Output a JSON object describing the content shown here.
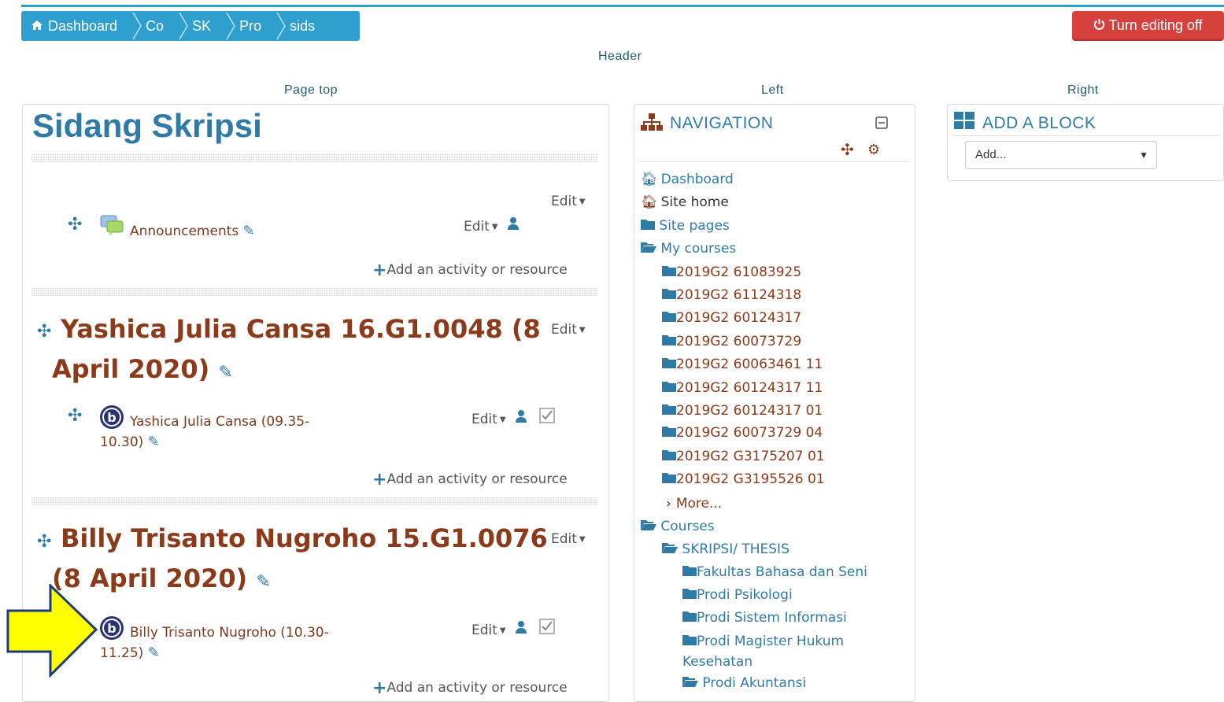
{
  "breadcrumb": [
    "Dashboard",
    "Co",
    "SK",
    "Pro",
    "sids"
  ],
  "turn_editing_label": "Turn editing off",
  "regions": {
    "header": "Header",
    "page_top": "Page top",
    "left": "Left",
    "right": "Right"
  },
  "course_title": "Sidang Skripsi",
  "edit_label": "Edit",
  "add_activity_label": "Add an activity or resource",
  "announcements_label": "Announcements",
  "sections": [
    {
      "title_line1": "Yashica Julia Cansa 16.G1.0048 (8",
      "title_line2": "April 2020)",
      "activity_line1": "Yashica Julia Cansa (09.35-",
      "activity_line2": "10.30)"
    },
    {
      "title_line1": "Billy Trisanto Nugroho 15.G1.0076",
      "title_line2": "(8 April 2020)",
      "activity_line1": "Billy Trisanto Nugroho (10.30-",
      "activity_line2": "11.25)"
    }
  ],
  "navigation": {
    "title": "NAVIGATION",
    "items": [
      "Dashboard",
      "Site home",
      "Site pages",
      "My courses"
    ],
    "courses": [
      "2019G2 61083925",
      "2019G2 61124318",
      "2019G2 60124317",
      "2019G2 60073729",
      "2019G2 60063461 11",
      "2019G2 60124317 11",
      "2019G2 60124317 01",
      "2019G2 60073729 04",
      "2019G2 G3175207 01",
      "2019G2 G3195526 01"
    ],
    "more": "More...",
    "courses_label": "Courses",
    "category": "SKRIPSI/ THESIS",
    "subcategories": [
      "Fakultas Bahasa dan Seni",
      "Prodi Psikologi",
      "Prodi Sistem Informasi",
      "Prodi Magister Hukum",
      "Kesehatan",
      "Prodi Akuntansi"
    ]
  },
  "add_block": {
    "title": "ADD A BLOCK",
    "select_value": "Add..."
  }
}
